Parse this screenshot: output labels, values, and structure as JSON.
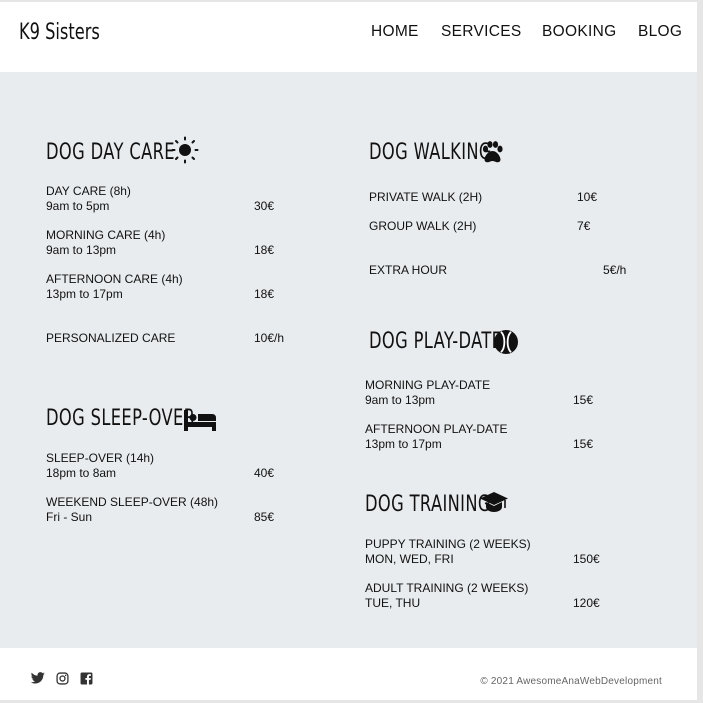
{
  "header": {
    "brand": "K9 Sisters",
    "nav": [
      "HOME",
      "SERVICES",
      "BOOKING",
      "BLOG"
    ]
  },
  "sections": {
    "day_care": {
      "title": "DOG DAY CARE",
      "icon": "sun-icon",
      "items": [
        {
          "name": "DAY CARE (8h)",
          "hours": "9am to 5pm",
          "price": "30€"
        },
        {
          "name": "MORNING CARE (4h)",
          "hours": "9am to 13pm",
          "price": "18€"
        },
        {
          "name": "AFTERNOON CARE (4h)",
          "hours": "13pm to 17pm",
          "price": "18€"
        },
        {
          "name": "PERSONALIZED CARE",
          "price": "10€/h"
        }
      ]
    },
    "sleep_over": {
      "title": "DOG SLEEP-OVER",
      "icon": "bed-icon",
      "items": [
        {
          "name": "SLEEP-OVER  (14h)",
          "hours": "18pm to 8am",
          "price": "40€"
        },
        {
          "name": "WEEKEND SLEEP-OVER (48h)",
          "hours": "Fri - Sun",
          "price": "85€"
        }
      ]
    },
    "walking": {
      "title": "DOG WALKING",
      "icon": "paw-icon",
      "items": [
        {
          "name": "PRIVATE WALK  (2H)",
          "price": "10€"
        },
        {
          "name": "GROUP WALK (2H)",
          "price": "7€"
        },
        {
          "name": "EXTRA HOUR",
          "price": "5€/h"
        }
      ]
    },
    "play_date": {
      "title": "DOG PLAY-DATE",
      "icon": "tennis-ball-icon",
      "items": [
        {
          "name": "MORNING PLAY-DATE",
          "hours": "9am to 13pm",
          "price": "15€"
        },
        {
          "name": "AFTERNOON PLAY-DATE",
          "hours": "13pm to 17pm",
          "price": "15€"
        }
      ]
    },
    "training": {
      "title": "DOG TRAINING",
      "icon": "graduation-cap-icon",
      "items": [
        {
          "name": "PUPPY TRAINING (2 WEEKS)",
          "hours": "MON, WED, FRI",
          "price": "150€"
        },
        {
          "name": "ADULT TRAINING (2 WEEKS)",
          "hours": "TUE, THU",
          "price": "120€"
        }
      ]
    }
  },
  "footer": {
    "social": [
      "twitter-icon",
      "instagram-icon",
      "facebook-icon"
    ],
    "copyright": "© 2021 AwesomeAnaWebDevelopment"
  }
}
